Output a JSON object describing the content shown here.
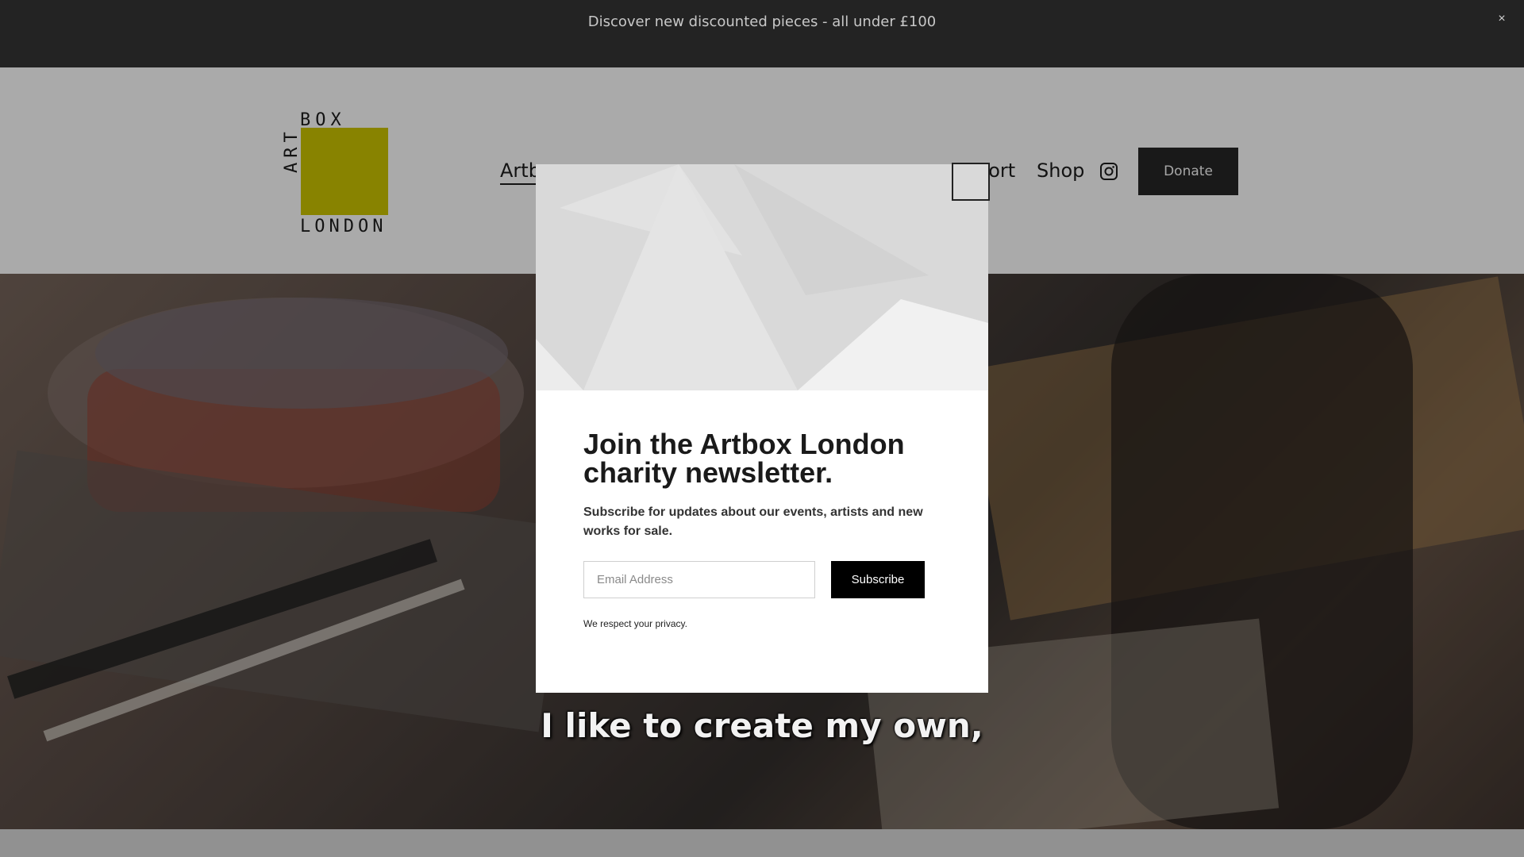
{
  "announcement": {
    "text": "Discover new discounted pieces - all under £100",
    "close_label": "×"
  },
  "logo": {
    "line_top": "BOX",
    "line_side": "ART",
    "line_bottom": "LONDON",
    "square_color": "#b8b100"
  },
  "nav": {
    "items": [
      {
        "label": "Artb",
        "active": true
      },
      {
        "label": "port"
      },
      {
        "label": "Shop"
      }
    ],
    "instagram_icon": "instagram-icon",
    "donate_label": "Donate"
  },
  "hero": {
    "caption": "I like to create my own,"
  },
  "modal": {
    "title": "Join the Artbox London charity newsletter.",
    "subtitle": "Subscribe for updates about our events, artists and new works for sale.",
    "email_placeholder": "Email Address",
    "subscribe_label": "Subscribe",
    "privacy": "We respect your privacy."
  }
}
